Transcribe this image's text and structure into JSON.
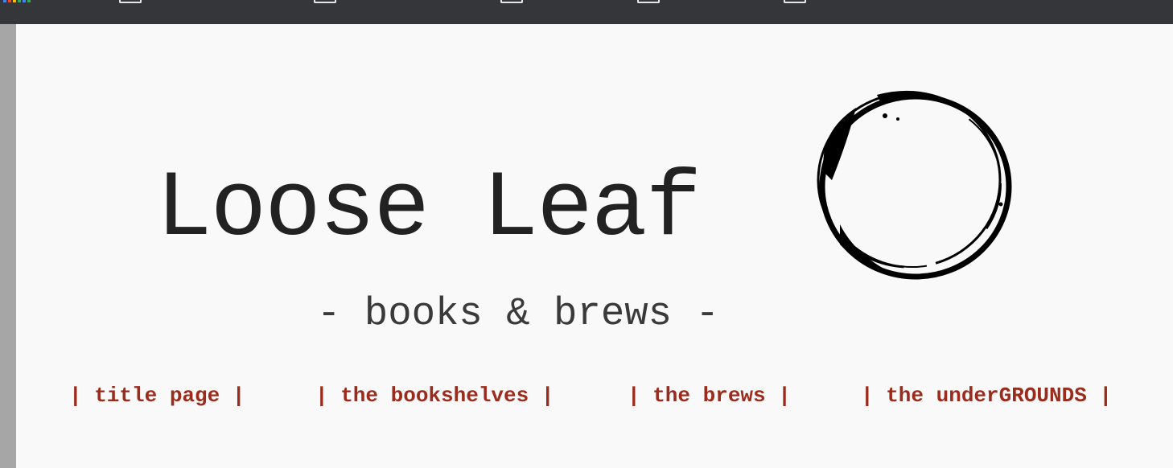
{
  "site": {
    "title": "Loose Leaf",
    "tagline": "- books & brews -",
    "logo_icon": "coffee-ring-icon"
  },
  "nav": {
    "items": [
      {
        "label": "| title page |"
      },
      {
        "label": "| the bookshelves |"
      },
      {
        "label": "| the brews |"
      },
      {
        "label": "| the underGROUNDS |"
      }
    ]
  },
  "colors": {
    "nav_link": "#9b2c1d",
    "title": "#222222",
    "tagline": "#3a3a3a",
    "page_background": "#f9f9f9",
    "bookmarks_bar": "#35363a"
  }
}
